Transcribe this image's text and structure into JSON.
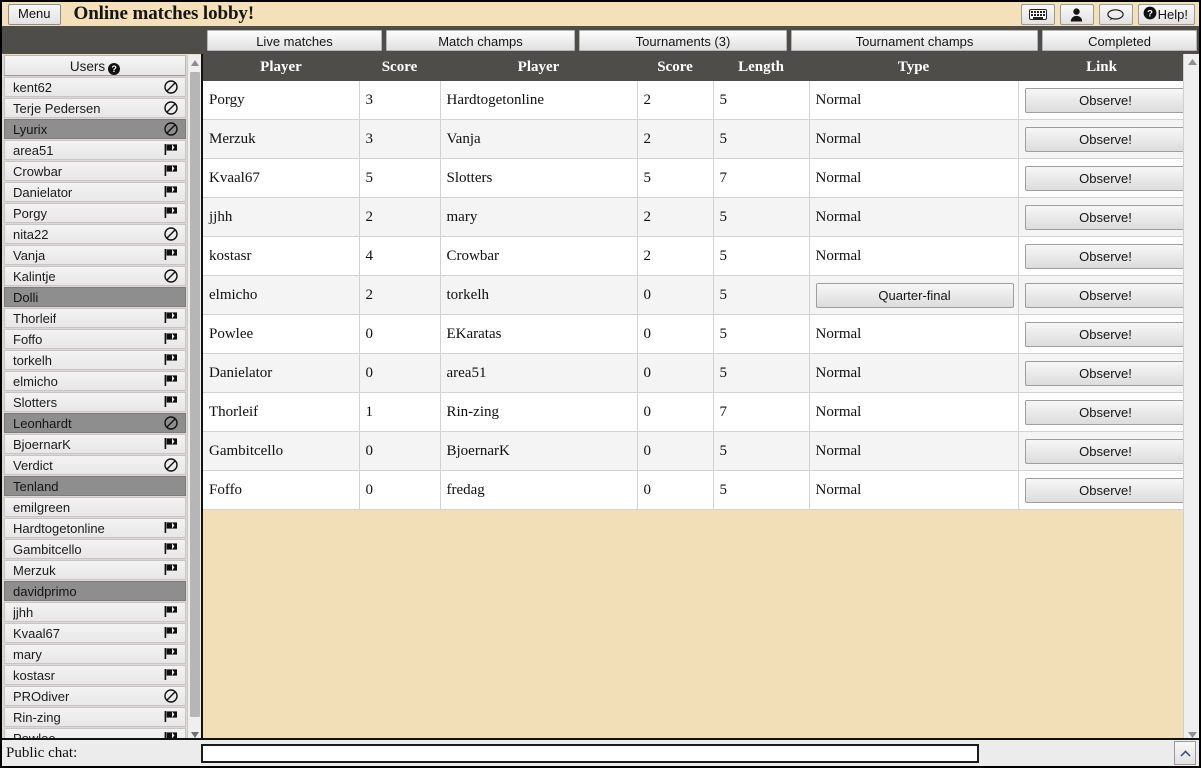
{
  "topbar": {
    "menu_label": "Menu",
    "title": "Online matches lobby!",
    "help_label": "Help!",
    "icons": [
      "keyboard-icon",
      "person-icon",
      "chat-bubble-icon"
    ]
  },
  "tabs": [
    {
      "label": "Live matches",
      "active": false
    },
    {
      "label": "Match champs",
      "active": false
    },
    {
      "label": "Tournaments (3)",
      "active": false
    },
    {
      "label": "Tournament champs",
      "active": false
    },
    {
      "label": "Completed",
      "active": false
    }
  ],
  "sidebar": {
    "header": "Users",
    "header_help_glyph": "?",
    "users": [
      {
        "name": "kent62",
        "icon": "no-entry",
        "selected": false
      },
      {
        "name": "Terje Pedersen",
        "icon": "no-entry",
        "selected": false
      },
      {
        "name": "Lyurix",
        "icon": "no-entry",
        "selected": true
      },
      {
        "name": "area51",
        "icon": "flag",
        "selected": false
      },
      {
        "name": "Crowbar",
        "icon": "flag",
        "selected": false
      },
      {
        "name": "Danielator",
        "icon": "flag",
        "selected": false
      },
      {
        "name": "Porgy",
        "icon": "flag",
        "selected": false
      },
      {
        "name": "nita22",
        "icon": "no-entry",
        "selected": false
      },
      {
        "name": "Vanja",
        "icon": "flag",
        "selected": false
      },
      {
        "name": "Kalintje",
        "icon": "no-entry",
        "selected": false
      },
      {
        "name": "Dolli",
        "icon": "none",
        "selected": true
      },
      {
        "name": "Thorleif",
        "icon": "flag",
        "selected": false
      },
      {
        "name": "Foffo",
        "icon": "flag",
        "selected": false
      },
      {
        "name": "torkelh",
        "icon": "flag",
        "selected": false
      },
      {
        "name": "elmicho",
        "icon": "flag",
        "selected": false
      },
      {
        "name": "Slotters",
        "icon": "flag",
        "selected": false
      },
      {
        "name": "Leonhardt",
        "icon": "no-entry",
        "selected": true
      },
      {
        "name": "BjoernarK",
        "icon": "flag",
        "selected": false
      },
      {
        "name": "Verdict",
        "icon": "no-entry",
        "selected": false
      },
      {
        "name": "Tenland",
        "icon": "none",
        "selected": true
      },
      {
        "name": "emilgreen",
        "icon": "none",
        "selected": false
      },
      {
        "name": "Hardtogetonline",
        "icon": "flag",
        "selected": false
      },
      {
        "name": "Gambitcello",
        "icon": "flag",
        "selected": false
      },
      {
        "name": "Merzuk",
        "icon": "flag",
        "selected": false
      },
      {
        "name": "davidprimo",
        "icon": "none",
        "selected": true
      },
      {
        "name": "jjhh",
        "icon": "flag",
        "selected": false
      },
      {
        "name": "Kvaal67",
        "icon": "flag",
        "selected": false
      },
      {
        "name": "mary",
        "icon": "flag",
        "selected": false
      },
      {
        "name": "kostasr",
        "icon": "flag",
        "selected": false
      },
      {
        "name": "PROdiver",
        "icon": "no-entry",
        "selected": false
      },
      {
        "name": "Rin-zing",
        "icon": "flag",
        "selected": false
      },
      {
        "name": "Powlee",
        "icon": "flag",
        "selected": false
      }
    ]
  },
  "table": {
    "columns": [
      "Player",
      "Score",
      "Player",
      "Score",
      "Length",
      "Type",
      "Link"
    ],
    "link_label": "Observe!",
    "rows": [
      {
        "player1": "Porgy",
        "score1": "3",
        "player2": "Hardtogetonline",
        "score2": "2",
        "length": "5",
        "type": "Normal",
        "type_is_button": false,
        "link": "Observe!"
      },
      {
        "player1": "Merzuk",
        "score1": "3",
        "player2": "Vanja",
        "score2": "2",
        "length": "5",
        "type": "Normal",
        "type_is_button": false,
        "link": "Observe!"
      },
      {
        "player1": "Kvaal67",
        "score1": "5",
        "player2": "Slotters",
        "score2": "5",
        "length": "7",
        "type": "Normal",
        "type_is_button": false,
        "link": "Observe!"
      },
      {
        "player1": "jjhh",
        "score1": "2",
        "player2": "mary",
        "score2": "2",
        "length": "5",
        "type": "Normal",
        "type_is_button": false,
        "link": "Observe!"
      },
      {
        "player1": "kostasr",
        "score1": "4",
        "player2": "Crowbar",
        "score2": "2",
        "length": "5",
        "type": "Normal",
        "type_is_button": false,
        "link": "Observe!"
      },
      {
        "player1": "elmicho",
        "score1": "2",
        "player2": "torkelh",
        "score2": "0",
        "length": "5",
        "type": "Quarter-final",
        "type_is_button": true,
        "link": "Observe!"
      },
      {
        "player1": "Powlee",
        "score1": "0",
        "player2": "EKaratas",
        "score2": "0",
        "length": "5",
        "type": "Normal",
        "type_is_button": false,
        "link": "Observe!"
      },
      {
        "player1": "Danielator",
        "score1": "0",
        "player2": "area51",
        "score2": "0",
        "length": "5",
        "type": "Normal",
        "type_is_button": false,
        "link": "Observe!"
      },
      {
        "player1": "Thorleif",
        "score1": "1",
        "player2": "Rin-zing",
        "score2": "0",
        "length": "7",
        "type": "Normal",
        "type_is_button": false,
        "link": "Observe!"
      },
      {
        "player1": "Gambitcello",
        "score1": "0",
        "player2": "BjoernarK",
        "score2": "0",
        "length": "5",
        "type": "Normal",
        "type_is_button": false,
        "link": "Observe!"
      },
      {
        "player1": "Foffo",
        "score1": "0",
        "player2": "fredag",
        "score2": "0",
        "length": "5",
        "type": "Normal",
        "type_is_button": false,
        "link": "Observe!"
      }
    ]
  },
  "chat": {
    "label": "Public chat:",
    "value": "",
    "placeholder": "",
    "expand_glyph": "ʌ"
  },
  "colors": {
    "page_background": "#f2dfb8",
    "header_bar": "#4f4d4a",
    "selected_user": "#8e8e8e",
    "row_alt": "#f4f4f4"
  }
}
